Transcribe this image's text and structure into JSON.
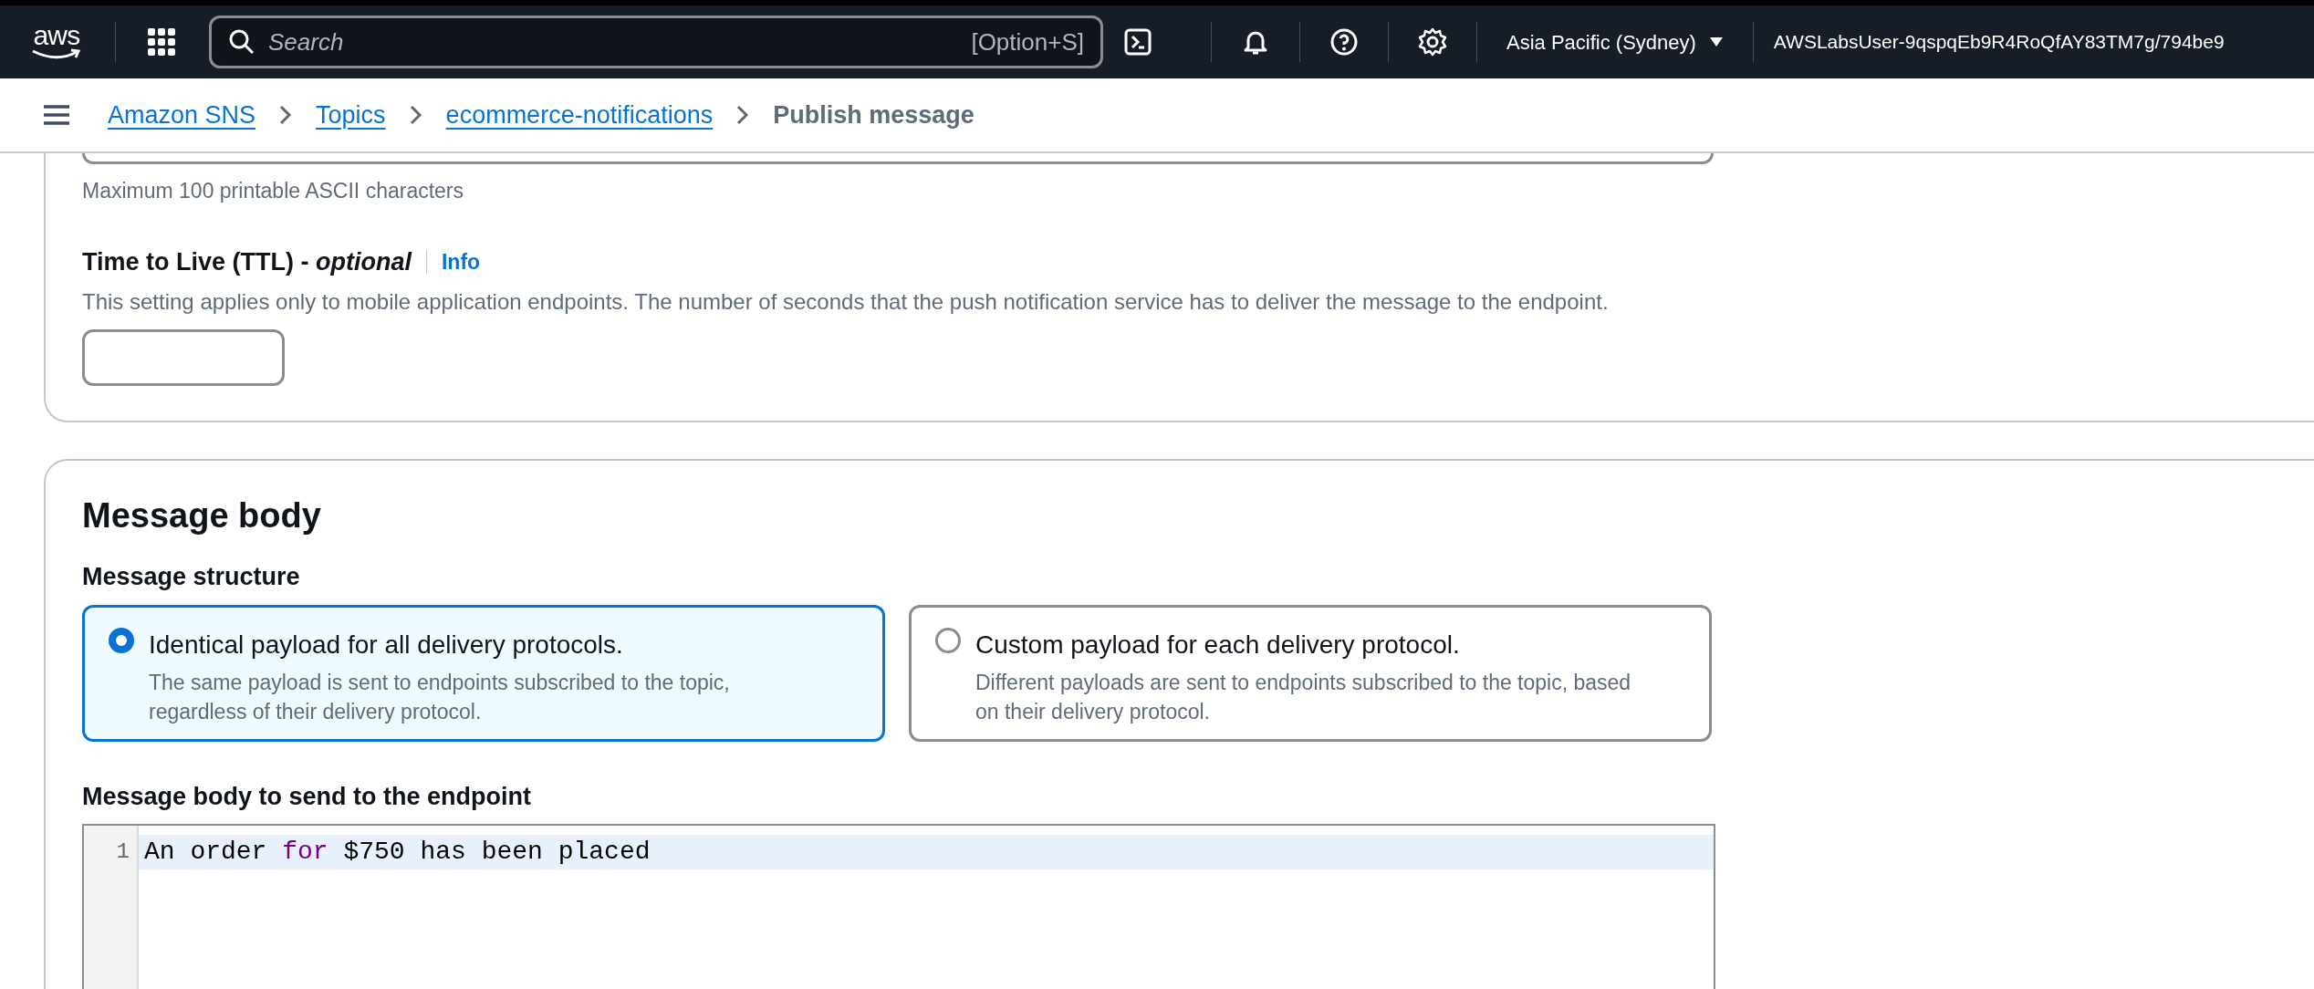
{
  "top_nav": {
    "logo": "aws",
    "search": {
      "placeholder": "Search",
      "shortcut": "[Option+S]"
    },
    "region": "Asia Pacific (Sydney)",
    "account": "AWSLabsUser-9qspqEb9R4RoQfAY83TM7g/794be9"
  },
  "breadcrumbs": [
    {
      "label": "Amazon SNS",
      "link": true
    },
    {
      "label": "Topics",
      "link": true
    },
    {
      "label": "ecommerce-notifications",
      "link": true
    },
    {
      "label": "Publish message",
      "link": false
    }
  ],
  "previous_field": {
    "hint": "Maximum 100 printable ASCII characters"
  },
  "ttl": {
    "label": "Time to Live (TTL) - *optional*",
    "info": "Info",
    "description": "This setting applies only to mobile application endpoints. The number of seconds that the push notification service has to deliver the message to the endpoint."
  },
  "message_body": {
    "title": "Message body",
    "structure_label": "Message structure",
    "options": [
      {
        "title": "Identical payload for all delivery protocols.",
        "description": "The same payload is sent to endpoints subscribed to the topic, regardless of their delivery protocol.",
        "selected": true
      },
      {
        "title": "Custom payload for each delivery protocol.",
        "description": "Different payloads are sent to endpoints subscribed to the topic, based on their delivery protocol.",
        "selected": false
      }
    ],
    "editor_label": "Message body to send to the endpoint",
    "editor_lines": [
      {
        "number": "1",
        "active": true,
        "tokens": [
          {
            "text": "An order ",
            "kind": "plain"
          },
          {
            "text": "for",
            "kind": "keyword"
          },
          {
            "text": " $750 has been placed",
            "kind": "plain"
          }
        ]
      }
    ]
  }
}
